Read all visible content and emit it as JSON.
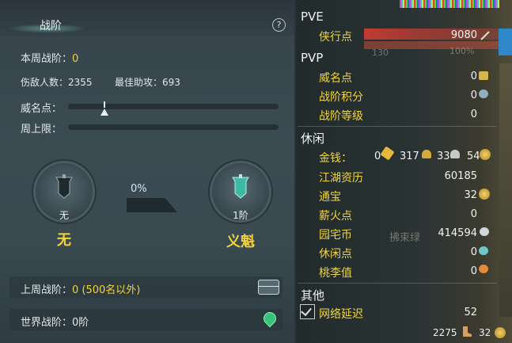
{
  "left_panel": {
    "header_title": "战阶",
    "help_label": "?",
    "weekly_rank_label": "本周战阶：",
    "weekly_rank_value": "0",
    "wound_count_label": "伤敌人数：",
    "wound_count_value": "2355",
    "best_assist_label": "最佳助攻：",
    "best_assist_value": "693",
    "prestige_label": "威名点：",
    "weekly_limit_label": "周上限：",
    "progress_pct": "0%",
    "current_rank": {
      "medal_label": "无",
      "name": "无"
    },
    "next_rank": {
      "medal_label": "1阶",
      "name": "义魁"
    },
    "last_week_rank_label": "上周战阶：",
    "last_week_rank_value": "0 (500名以外)",
    "world_rank_text": "世界战阶：0阶"
  },
  "right_panel": {
    "pve_title": "PVE",
    "pvp_title": "PVP",
    "leisure_title": "休闲",
    "other_title": "其他",
    "background_text": {
      "level_percent": "130",
      "pct_100": "100%",
      "ghost_name": "拂束绿"
    },
    "pve": [
      {
        "label": "侠行点",
        "value": "9080"
      }
    ],
    "pvp": [
      {
        "label": "威名点",
        "value": "0"
      },
      {
        "label": "战阶积分",
        "value": "0"
      },
      {
        "label": "战阶等级",
        "value": "0"
      }
    ],
    "money": {
      "label": "金钱：",
      "gold": "0",
      "silver1": "317",
      "silver2": "33",
      "copper": "54"
    },
    "leisure": [
      {
        "label": "江湖资历",
        "value": "60185"
      },
      {
        "label": "通宝",
        "value": "32"
      },
      {
        "label": "薪火点",
        "value": "0"
      },
      {
        "label": "园宅币",
        "value": "414594"
      },
      {
        "label": "休闲点",
        "value": "0"
      },
      {
        "label": "桃李值",
        "value": "0"
      }
    ],
    "other": [
      {
        "label": "网络延迟",
        "value": "52",
        "checked": true
      }
    ],
    "bottom_left_value": "2275",
    "bottom_right_value": "32"
  },
  "colors": {
    "accent_yellow": "#f2d43a",
    "panel_bg": "#3b4b52"
  }
}
